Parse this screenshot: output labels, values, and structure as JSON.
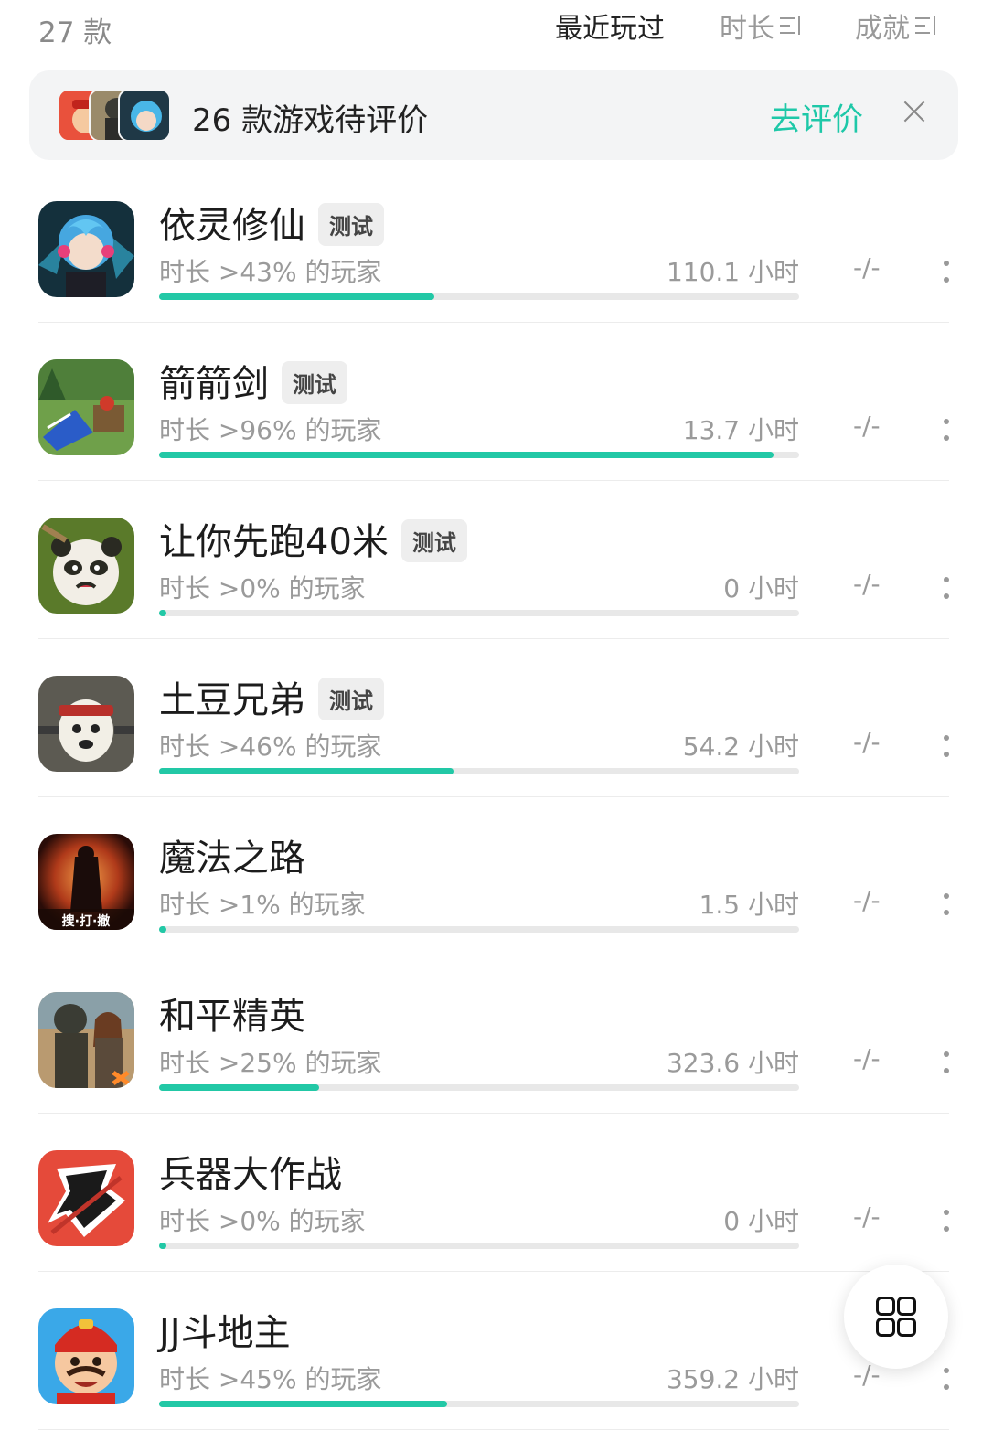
{
  "header": {
    "count": "27 款",
    "sort_recent": "最近玩过",
    "sort_duration": "时长",
    "sort_achievement": "成就"
  },
  "banner": {
    "text": "26 款游戏待评价",
    "action": "去评价"
  },
  "games": [
    {
      "name": "依灵修仙",
      "tag": "测试",
      "percentile": "时长 >43% 的玩家",
      "hours": "110.1 小时",
      "achievement": "-/-",
      "progress": 0.43
    },
    {
      "name": "箭箭剑",
      "tag": "测试",
      "percentile": "时长 >96% 的玩家",
      "hours": "13.7 小时",
      "achievement": "-/-",
      "progress": 0.96
    },
    {
      "name": "让你先跑40米",
      "tag": "测试",
      "percentile": "时长 >0% 的玩家",
      "hours": "0 小时",
      "achievement": "-/-",
      "progress": 0.01
    },
    {
      "name": "土豆兄弟",
      "tag": "测试",
      "percentile": "时长 >46% 的玩家",
      "hours": "54.2 小时",
      "achievement": "-/-",
      "progress": 0.46
    },
    {
      "name": "魔法之路",
      "tag": "",
      "percentile": "时长 >1% 的玩家",
      "hours": "1.5 小时",
      "achievement": "-/-",
      "progress": 0.01
    },
    {
      "name": "和平精英",
      "tag": "",
      "percentile": "时长 >25% 的玩家",
      "hours": "323.6 小时",
      "achievement": "-/-",
      "progress": 0.25
    },
    {
      "name": "兵器大作战",
      "tag": "",
      "percentile": "时长 >0% 的玩家",
      "hours": "0 小时",
      "achievement": "-/-",
      "progress": 0.01
    },
    {
      "name": "JJ斗地主",
      "tag": "",
      "percentile": "时长 >45% 的玩家",
      "hours": "359.2 小时",
      "achievement": "-/-",
      "progress": 0.45
    }
  ],
  "icon_text": {
    "mofa_badge": "搜·打·撤"
  },
  "colors": {
    "accent": "#22c8a6",
    "track": "#e8e8e8"
  }
}
